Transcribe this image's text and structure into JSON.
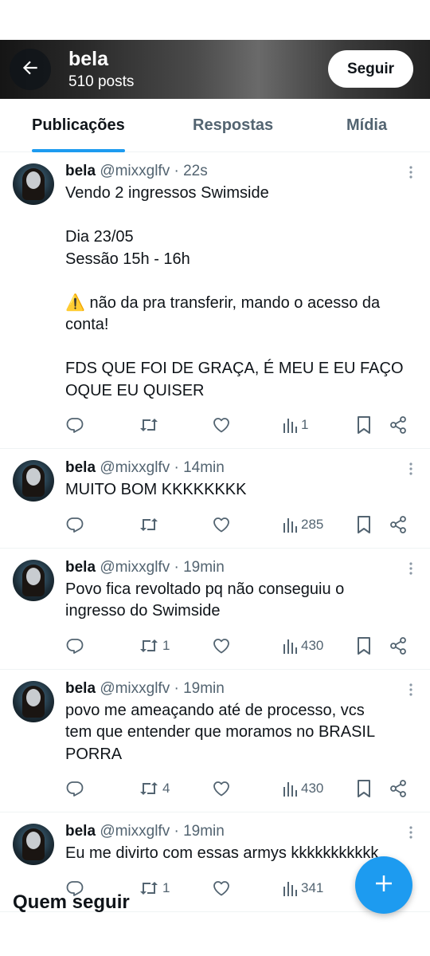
{
  "header": {
    "name": "bela",
    "posts_count": "510 posts",
    "follow_label": "Seguir"
  },
  "tabs": [
    {
      "label": "Publicações",
      "active": true
    },
    {
      "label": "Respostas",
      "active": false
    },
    {
      "label": "Mídia",
      "active": false
    }
  ],
  "posts": [
    {
      "name": "bela",
      "meta": "@mixxglfv · 22s",
      "lines": [
        "Vendo 2 ingressos Swimside",
        "",
        "Dia 23/05",
        "Sessão 15h - 16h",
        "",
        "⚠️ não da pra transferir, mando o acesso da",
        "conta!",
        "",
        "FDS QUE FOI DE GRAÇA, É MEU E EU FAÇO",
        "OQUE EU QUISER"
      ],
      "retweets": "",
      "views": "1"
    },
    {
      "name": "bela",
      "meta": "@mixxglfv · 14min",
      "lines": [
        "MUITO BOM KKKKKKKK"
      ],
      "retweets": "",
      "views": "285"
    },
    {
      "name": "bela",
      "meta": "@mixxglfv · 19min",
      "lines": [
        "Povo fica revoltado pq não conseguiu o",
        "ingresso do Swimside"
      ],
      "retweets": "1",
      "views": "430"
    },
    {
      "name": "bela",
      "meta": "@mixxglfv · 19min",
      "lines": [
        "povo me ameaçando até de processo, vcs",
        "tem que entender que moramos no BRASIL",
        "PORRA"
      ],
      "retweets": "4",
      "views": "430"
    },
    {
      "name": "bela",
      "meta": "@mixxglfv · 19min",
      "lines": [
        "Eu me divirto com essas armys kkkkkkkkkkk"
      ],
      "retweets": "1",
      "views": "341"
    }
  ],
  "who_to_follow": "Quem seguir",
  "colors": {
    "accent": "#1d9bf0",
    "text": "#0f1419",
    "muted": "#536471",
    "divider": "#eff3f4"
  },
  "icons": [
    "back-arrow-icon",
    "more-icon",
    "reply-icon",
    "retweet-icon",
    "like-icon",
    "views-icon",
    "bookmark-icon",
    "share-icon",
    "plus-icon"
  ]
}
